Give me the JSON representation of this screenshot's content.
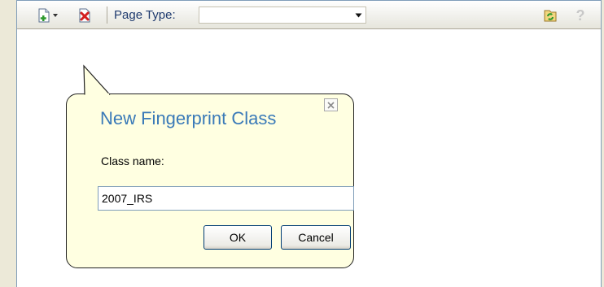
{
  "toolbar": {
    "page_type_label": "Page Type:",
    "page_type_value": "",
    "icons": {
      "new_page": "new-page-icon",
      "delete": "delete-icon",
      "refresh": "refresh-icon",
      "help": "help-icon"
    },
    "help_glyph": "?"
  },
  "dialog": {
    "title": "New Fingerprint Class",
    "class_name_label": "Class name:",
    "class_name_value": "2007_IRS",
    "ok_label": "OK",
    "cancel_label": "Cancel",
    "close_glyph": "×"
  },
  "colors": {
    "title_blue": "#3a7ab8",
    "callout_bg": "#ffffe1",
    "window_bg": "#ece9d8"
  }
}
